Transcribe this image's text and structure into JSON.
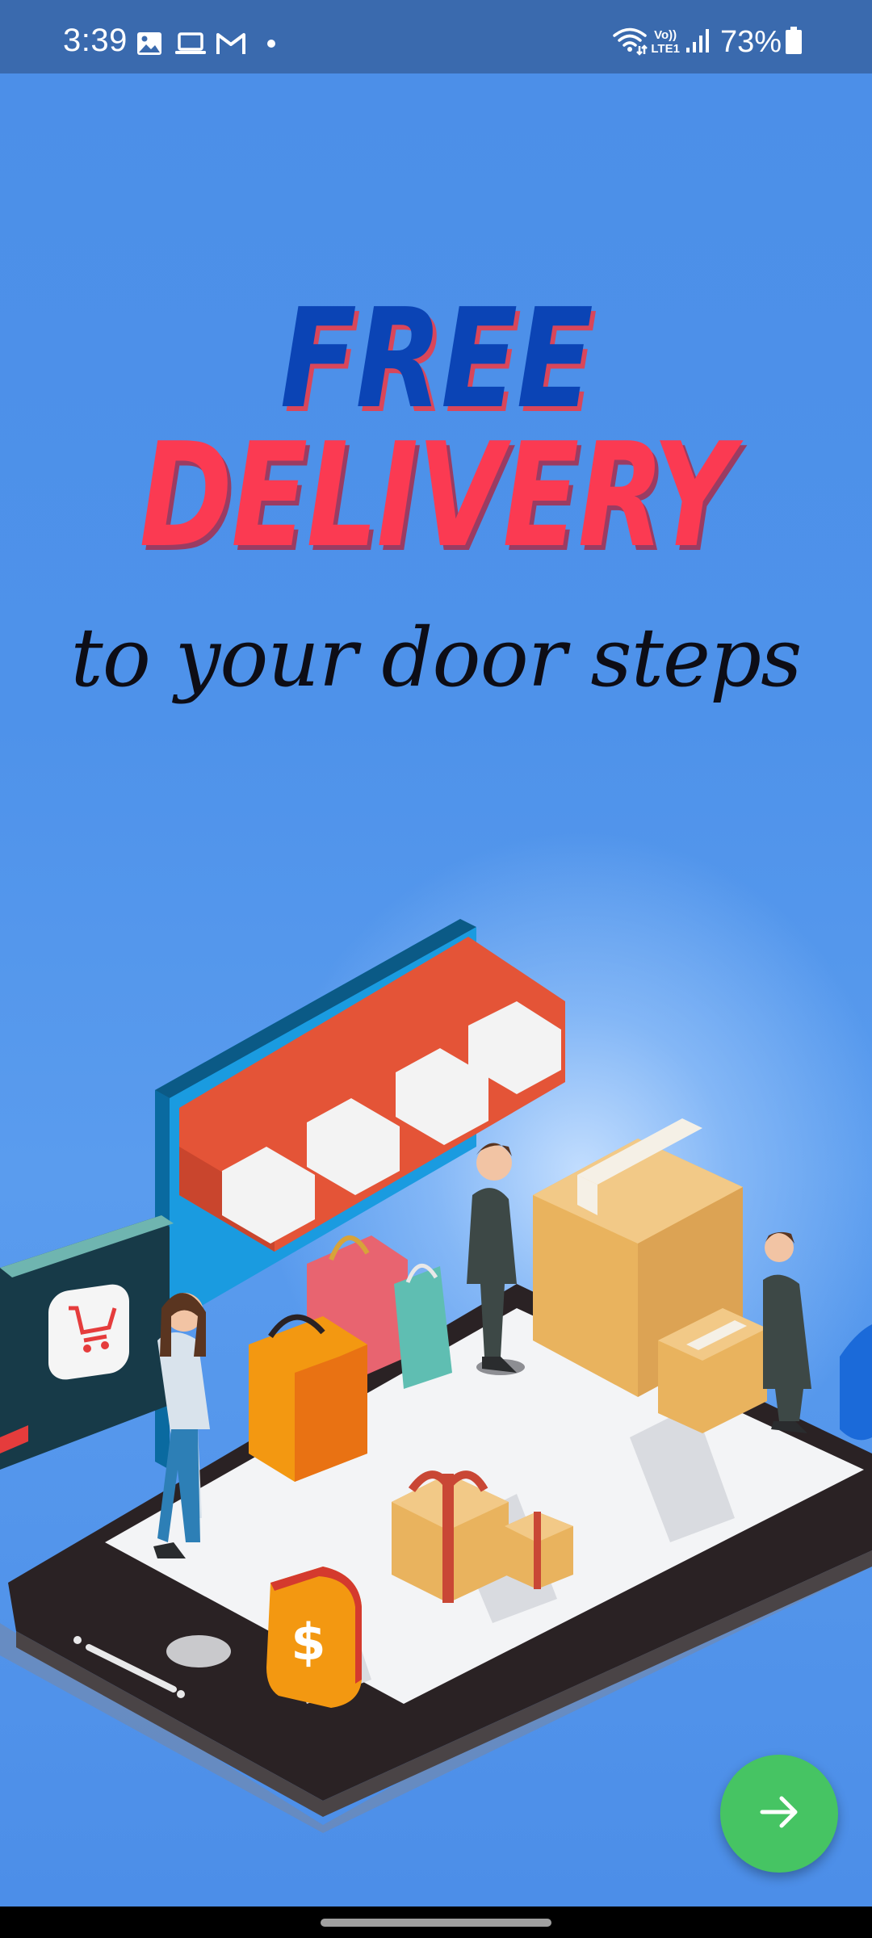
{
  "status_bar": {
    "time": "3:39",
    "battery": "73%",
    "icons_left": [
      "image-icon",
      "laptop-icon",
      "gmail-icon",
      "dot-icon"
    ],
    "icons_right": [
      "wifi-icon",
      "volte-icon",
      "signal-icon",
      "battery-icon"
    ],
    "volte_line1": "Vo))",
    "volte_line2": "LTE1"
  },
  "hero": {
    "line1": "FREE",
    "line2": "DELIVERY",
    "tagline": "to your door steps"
  },
  "fab": {
    "icon": "arrow-right-icon"
  },
  "colors": {
    "status_bar_bg": "#3a6aae",
    "background": "#4c8fe8",
    "free_text": "#0b44b5",
    "delivery_text": "#fb3a52",
    "fab": "#46c463"
  }
}
